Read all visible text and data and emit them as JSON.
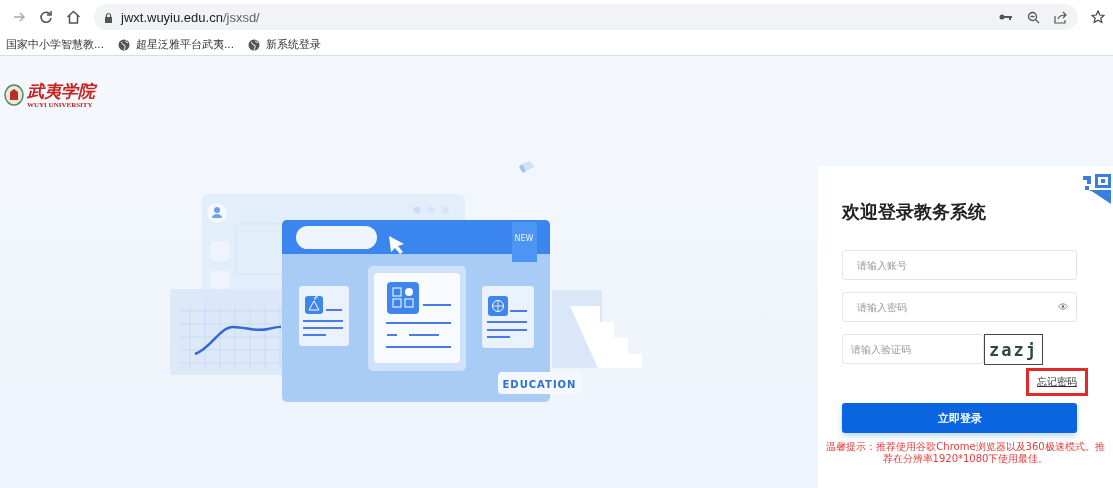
{
  "browser": {
    "url_host": "jwxt.wuyiu.edu.cn",
    "url_path": "/jsxsd/"
  },
  "bookmarks": [
    {
      "label": "国家中小学智慧教..."
    },
    {
      "label": "超星泛雅平台武夷..."
    },
    {
      "label": "新系统登录"
    }
  ],
  "logo": {
    "name": "武夷学院",
    "subtitle": "WUYI UNIVERSITY"
  },
  "illustration": {
    "badge": "NEW",
    "label": "EDUCATION"
  },
  "login": {
    "title": "欢迎登录教务系统",
    "fields": [
      {
        "kind": "text",
        "placeholder": "请输入账号"
      },
      {
        "kind": "password",
        "placeholder": "请输入密码"
      },
      {
        "kind": "captcha",
        "placeholder": "请输入验证码",
        "captcha": "zazj"
      }
    ],
    "forgot": {
      "label": "忘记密码",
      "highlighted": true
    },
    "submit": "立即登录",
    "notice": "温馨提示：推荐使用谷歌Chrome浏览器以及360极速模式。推荐在分辨率1920*1080下使用最佳。"
  }
}
